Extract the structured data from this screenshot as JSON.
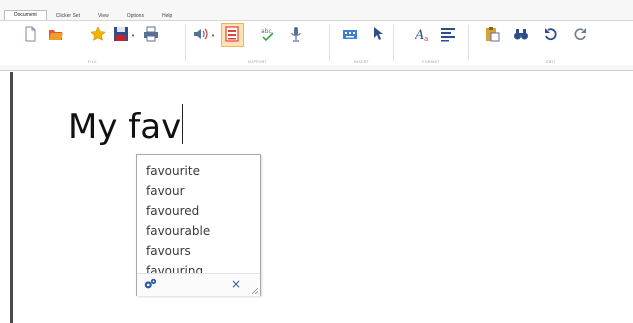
{
  "tabs": [
    "Document",
    "Clicker Set",
    "View",
    "Options",
    "Help"
  ],
  "groups": {
    "file": "FILE",
    "support": "SUPPORT",
    "insert": "INSERT",
    "format": "FORMAT",
    "edit": "EDIT"
  },
  "icons": {
    "file": [
      "new-document-icon",
      "open-folder-icon",
      "favourite-star-icon",
      "save-icon",
      "print-icon"
    ],
    "support": [
      "speech-icon",
      "prediction-icon",
      "spell-check-icon",
      "microphone-icon"
    ],
    "insert": [
      "keyboard-icon",
      "pointer-icon"
    ],
    "format": [
      "font-icon",
      "align-icon"
    ],
    "edit": [
      "paste-icon",
      "find-icon",
      "undo-icon",
      "redo-icon"
    ]
  },
  "colors": {
    "accent": "#f0b35f",
    "accent_fill": "#fce2b4",
    "close": "#2a5aa8"
  },
  "document": {
    "text": "My fav"
  },
  "predictions": [
    "favourite",
    "favour",
    "favoured",
    "favourable",
    "favours",
    "favouring"
  ],
  "popup_footer": {
    "settings_icon": "settings-icon",
    "close_label": "×"
  }
}
